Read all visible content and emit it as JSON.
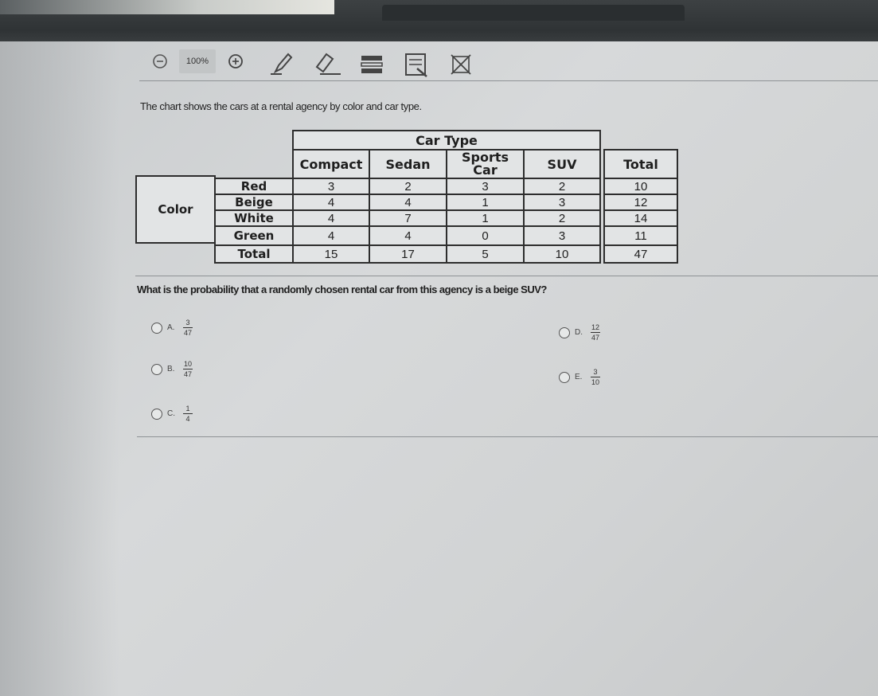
{
  "toolbar": {
    "zoom_level": "100%",
    "icons": [
      "zoom-out-icon",
      "zoom-in-icon",
      "pencil-icon",
      "eraser-icon",
      "highlighter-icon",
      "line-reader-icon",
      "answer-eliminator-icon"
    ]
  },
  "question_text": "The chart shows the cars at a rental agency by color and car type.",
  "table": {
    "group_header": "Car Type",
    "row_group_label": "Color",
    "columns": [
      "Compact",
      "Sedan",
      "Sports Car",
      "SUV",
      "Total"
    ],
    "rows": [
      {
        "label": "Red",
        "values": [
          "3",
          "2",
          "3",
          "2",
          "10"
        ]
      },
      {
        "label": "Beige",
        "values": [
          "4",
          "4",
          "1",
          "3",
          "12"
        ]
      },
      {
        "label": "White",
        "values": [
          "4",
          "7",
          "1",
          "2",
          "14"
        ]
      },
      {
        "label": "Green",
        "values": [
          "4",
          "4",
          "0",
          "3",
          "11"
        ]
      },
      {
        "label": "Total",
        "values": [
          "15",
          "17",
          "5",
          "10",
          "47"
        ]
      }
    ]
  },
  "prompt": "What is the probability that a randomly chosen rental car from this agency is a beige SUV?",
  "options": [
    {
      "letter": "A.",
      "num": "3",
      "den": "47"
    },
    {
      "letter": "B.",
      "num": "10",
      "den": "47"
    },
    {
      "letter": "C.",
      "num": "1",
      "den": "4"
    },
    {
      "letter": "D.",
      "num": "12",
      "den": "47"
    },
    {
      "letter": "E.",
      "num": "3",
      "den": "10"
    }
  ],
  "colors": {
    "ink": "#2d2d2d",
    "screen": "#d7d9da",
    "bezel": "#2f3335"
  }
}
